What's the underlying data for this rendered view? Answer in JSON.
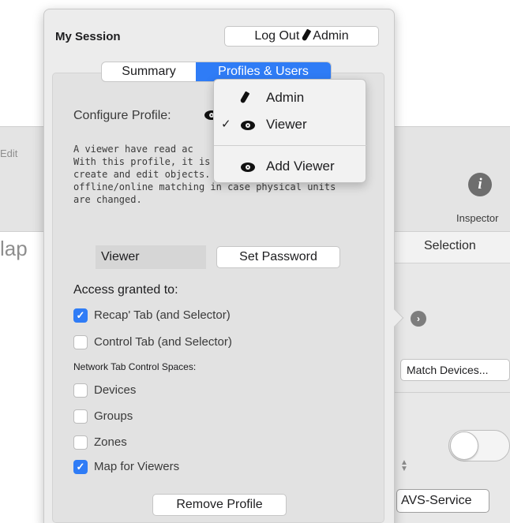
{
  "background": {
    "edit_label": "Edit",
    "inspector_label": "Inspector",
    "info_icon": "i",
    "map_label": "lap",
    "selection_label": "Selection",
    "arrow_icon": "›",
    "match_devices_button": "Match Devices...",
    "avs_service_button": "AVS-Service",
    "stepper_icon": "stepper-icon"
  },
  "session": {
    "title": "My Session",
    "logout_label": "Log Out",
    "user_label": "Admin",
    "tabs": [
      {
        "label": "Summary",
        "active": false
      },
      {
        "label": "Profiles & Users",
        "active": true
      }
    ],
    "configure_label": "Configure Profile:",
    "description_lines": [
      "A viewer have read ac",
      "With this profile, it is no",
      "create and edit objects.",
      "offline/online matching in case physical units",
      "are changed."
    ],
    "profile_name": "Viewer",
    "set_password_label": "Set Password",
    "access_title": "Access granted to:",
    "access_items": [
      {
        "label": "Recap' Tab (and Selector)",
        "checked": true
      },
      {
        "label": "Control Tab (and Selector)",
        "checked": false
      }
    ],
    "network_heading": "Network Tab Control Spaces:",
    "network_items": [
      {
        "label": "Devices",
        "checked": false
      },
      {
        "label": "Groups",
        "checked": false
      },
      {
        "label": "Zones",
        "checked": false
      },
      {
        "label": "Map for Viewers",
        "checked": true
      }
    ],
    "remove_profile_label": "Remove Profile"
  },
  "profile_menu": {
    "items": [
      {
        "label": "Admin",
        "icon": "pencil-icon",
        "checked": false
      },
      {
        "label": "Viewer",
        "icon": "eye-icon",
        "checked": true
      },
      {
        "label": "Add Viewer",
        "icon": "eye-icon",
        "checked": false
      }
    ],
    "check_glyph": "✓"
  },
  "colors": {
    "accent": "#2f7cf6",
    "popover_bg": "#ececec",
    "panel_bg": "#e2e2e2"
  }
}
